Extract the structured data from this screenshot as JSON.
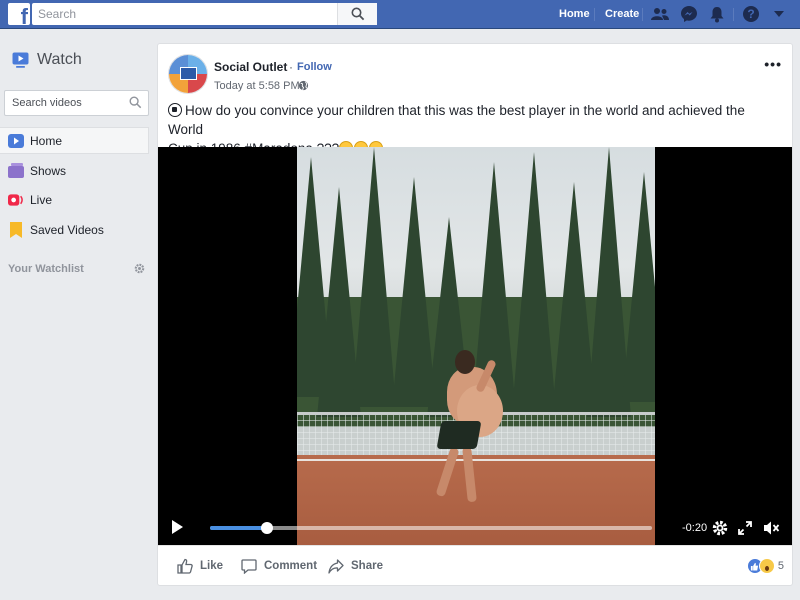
{
  "topbar": {
    "logo_letter": "f",
    "search_placeholder": "Search",
    "home_label": "Home",
    "create_label": "Create",
    "icons": [
      "friends-icon",
      "messenger-icon",
      "notifications-icon",
      "help-icon",
      "dropdown-arrow-icon"
    ]
  },
  "sidebar": {
    "title": "Watch",
    "search_placeholder": "Search videos",
    "items": [
      {
        "label": "Home",
        "icon": "play-icon",
        "active": true
      },
      {
        "label": "Shows",
        "icon": "shows-icon",
        "active": false
      },
      {
        "label": "Live",
        "icon": "live-icon",
        "active": false
      },
      {
        "label": "Saved Videos",
        "icon": "bookmark-icon",
        "active": false
      }
    ],
    "watchlist_label": "Your Watchlist"
  },
  "post": {
    "page_name": "Social Outlet",
    "separator": "·",
    "follow_label": "Follow",
    "timestamp": "Today at 5:58 PM",
    "separator_small": "·",
    "more_label": "•••",
    "text_line1": "How do you convince your children that this was the best player in the world and achieved the World",
    "text_line2": "Cup in 1986 #Maradona ???"
  },
  "video": {
    "time_remaining": "-0:20",
    "progress_fraction": 0.13
  },
  "actions": {
    "like_label": "Like",
    "comment_label": "Comment",
    "share_label": "Share",
    "reaction_count": "5"
  },
  "colors": {
    "brand": "#4267b2",
    "link": "#4267b2",
    "progress": "#4a90e2",
    "live_red": "#f02849"
  }
}
